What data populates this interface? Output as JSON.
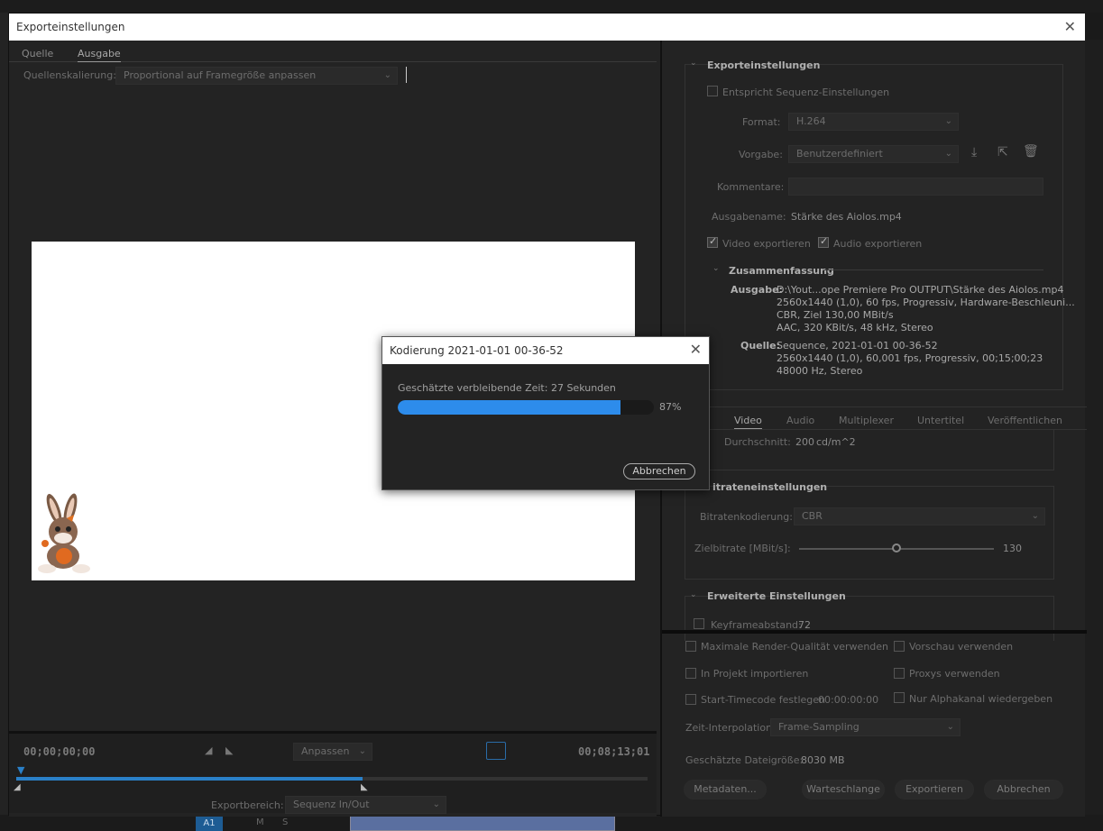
{
  "window": {
    "title": "Exporteinstellungen"
  },
  "left": {
    "tabs": [
      "Quelle",
      "Ausgabe"
    ],
    "scale_label": "Quellenskalierung:",
    "scale_value": "Proportional auf Framegröße anpassen",
    "timecode_start": "00;00;00;00",
    "timecode_end": "00;08;13;01",
    "fit_value": "Anpassen",
    "range_label": "Exportbereich:",
    "range_value": "Sequenz In/Out"
  },
  "export_settings": {
    "heading": "Exporteinstellungen",
    "match_sequence": "Entspricht Sequenz-Einstellungen",
    "format_label": "Format:",
    "format_value": "H.264",
    "preset_label": "Vorgabe:",
    "preset_value": "Benutzerdefiniert",
    "comments_label": "Kommentare:",
    "output_name_label": "Ausgabename:",
    "output_name_value": "Stärke des Aiolos.mp4",
    "export_video": "Video exportieren",
    "export_audio": "Audio exportieren"
  },
  "summary": {
    "heading": "Zusammenfassung",
    "output_label": "Ausgabe:",
    "output_lines": [
      "D:\\Yout...ope Premiere Pro OUTPUT\\Stärke des Aiolos.mp4",
      "2560x1440 (1,0), 60 fps, Progressiv, Hardware-Beschleuni...",
      "CBR, Ziel 130,00 MBit/s",
      "AAC, 320 KBit/s, 48 kHz, Stereo"
    ],
    "source_label": "Quelle:",
    "source_lines": [
      "Sequence, 2021-01-01 00-36-52",
      "2560x1440 (1,0), 60,001 fps, Progressiv, 00;15;00;23",
      "48000 Hz, Stereo"
    ]
  },
  "right_tabs": [
    "Video",
    "Audio",
    "Multiplexer",
    "Untertitel",
    "Veröffentlichen"
  ],
  "video": {
    "avg_label": "Durchschnitt:",
    "avg_value": "200",
    "avg_unit": "cd/m^2",
    "bitrate_heading": "itrateneinstellungen",
    "bitrate_encoding_label": "Bitratenkodierung:",
    "bitrate_encoding_value": "CBR",
    "target_bitrate_label": "Zielbitrate [MBit/s]:",
    "target_bitrate_value": "130",
    "target_bitrate_fraction": 0.5,
    "advanced_heading": "Erweiterte Einstellungen",
    "keyframe_label": "Keyframeabstand:",
    "keyframe_value": "72"
  },
  "options": {
    "max_render": "Maximale Render-Qualität verwenden",
    "preview": "Vorschau verwenden",
    "import_project": "In Projekt importieren",
    "proxies": "Proxys verwenden",
    "start_timecode": "Start-Timecode festlegen",
    "start_timecode_value": "00:00:00:00",
    "alpha_only": "Nur Alphakanal wiedergeben",
    "time_interp_label": "Zeit-Interpolation:",
    "time_interp_value": "Frame-Sampling",
    "filesize_label": "Geschätzte Dateigröße:",
    "filesize_value": "8030 MB"
  },
  "buttons": {
    "metadata": "Metadaten...",
    "queue": "Warteschlange",
    "export": "Exportieren",
    "cancel": "Abbrechen"
  },
  "encoding_dialog": {
    "title": "Kodierung 2021-01-01 00-36-52",
    "remaining": "Geschätzte verbleibende Zeit: 27 Sekunden",
    "progress_fraction": 0.87,
    "progress_text": "87%",
    "cancel": "Abbrechen"
  },
  "bottom_strip": {
    "track": "A1",
    "m": "M",
    "s": "S"
  },
  "colors": {
    "accent": "#2d8ceb",
    "timeline": "#2a80c8"
  }
}
